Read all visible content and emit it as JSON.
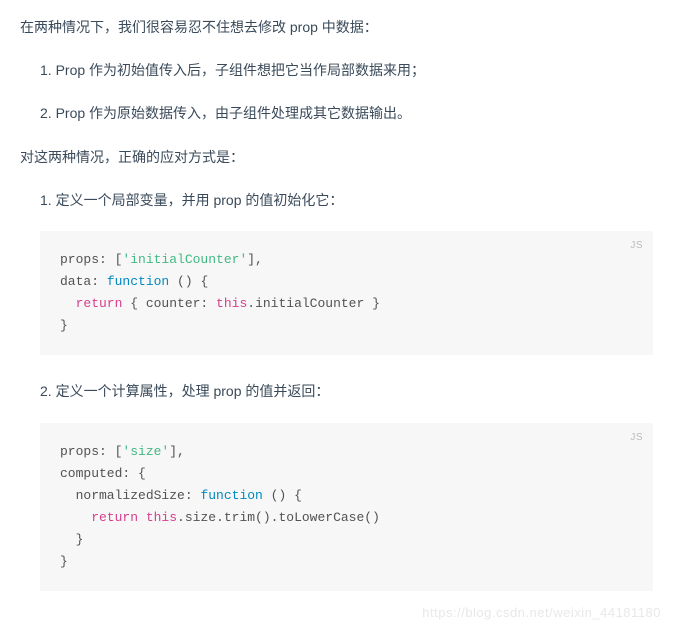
{
  "intro": "在两种情况下，我们很容易忍不住想去修改 prop 中数据：",
  "cases": [
    "1. Prop 作为初始值传入后，子组件想把它当作局部数据来用；",
    "2. Prop 作为原始数据传入，由子组件处理成其它数据输出。"
  ],
  "solutions_intro": "对这两种情况，正确的应对方式是：",
  "solutions": [
    {
      "label": "1. 定义一个局部变量，并用 prop 的值初始化它：",
      "lang": "JS",
      "code": {
        "line1_a": "props: [",
        "line1_str": "'initialCounter'",
        "line1_b": "],",
        "line2_a": "data: ",
        "line2_fn": "function",
        "line2_b": " () {",
        "line3_ret": "  return",
        "line3_a": " { counter: ",
        "line3_this": "this",
        "line3_b": ".initialCounter }",
        "line4": "}"
      }
    },
    {
      "label": "2. 定义一个计算属性，处理 prop 的值并返回：",
      "lang": "JS",
      "code": {
        "line1_a": "props: [",
        "line1_str": "'size'",
        "line1_b": "],",
        "line2": "computed: {",
        "line3_a": "  normalizedSize: ",
        "line3_fn": "function",
        "line3_b": " () {",
        "line4_ret": "    return",
        "line4_a": " ",
        "line4_this": "this",
        "line4_b": ".size.trim().toLowerCase()",
        "line5": "  }",
        "line6": "}"
      }
    }
  ],
  "watermark": "https://blog.csdn.net/weixin_44181180"
}
